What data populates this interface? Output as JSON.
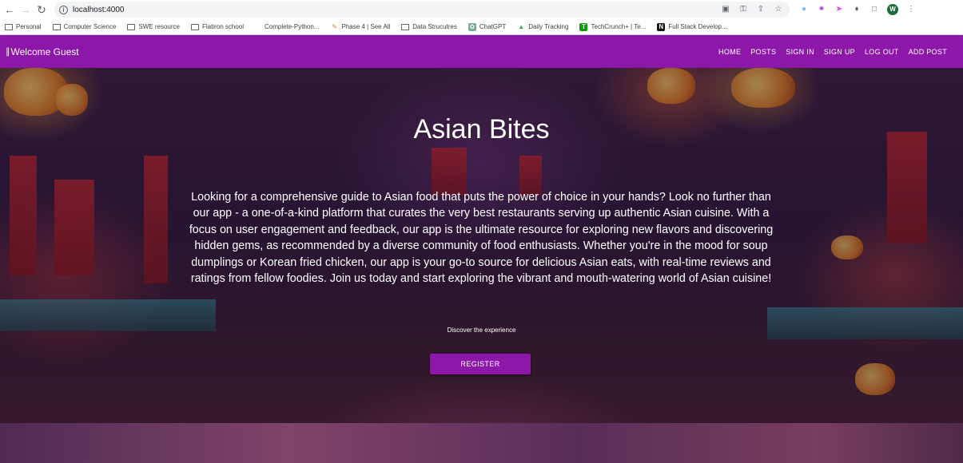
{
  "browser": {
    "url": "localhost:4000",
    "avatar_letter": "W",
    "bookmarks": [
      {
        "label": "Personal",
        "icon": "folder-icon"
      },
      {
        "label": "Computer Science",
        "icon": "folder-icon"
      },
      {
        "label": "SWE resource",
        "icon": "folder-icon"
      },
      {
        "label": "Flatiron school",
        "icon": "folder-icon"
      },
      {
        "label": "Complete-Python...",
        "icon": "page-icon"
      },
      {
        "label": "Phase 4 | See All",
        "icon": "pencil-icon"
      },
      {
        "label": "Data Strucutres",
        "icon": "folder-icon"
      },
      {
        "label": "ChatGPT",
        "icon": "chatgpt-icon"
      },
      {
        "label": "Daily Tracking",
        "icon": "drive-icon"
      },
      {
        "label": "TechCrunch+ | Te...",
        "icon": "techcrunch-icon"
      },
      {
        "label": "Full Stack Develop...",
        "icon": "notion-icon"
      }
    ]
  },
  "nav": {
    "brand": "Welcome Guest",
    "brand_icon": "restaurant-icon",
    "links": [
      "HOME",
      "POSTS",
      "SIGN IN",
      "SIGN UP",
      "LOG OUT",
      "ADD POST"
    ]
  },
  "hero": {
    "title": "Asian Bites",
    "description": "Looking for a comprehensive guide to Asian food that puts the power of choice in your hands? Look no further than our app - a one-of-a-kind platform that curates the very best restaurants serving up authentic Asian cuisine. With a focus on user engagement and feedback, our app is the ultimate resource for exploring new flavors and discovering hidden gems, as recommended by a diverse community of food enthusiasts. Whether you're in the mood for soup dumplings or Korean fried chicken, our app is your go-to source for delicious Asian eats, with real-time reviews and ratings from fellow foodies. Join us today and start exploring the vibrant and mouth-watering world of Asian cuisine!",
    "tagline": "Discover the experience",
    "register_label": "REGISTER"
  },
  "colors": {
    "nav_bg": "#8c17a9",
    "button_bg": "#8c17a9"
  }
}
